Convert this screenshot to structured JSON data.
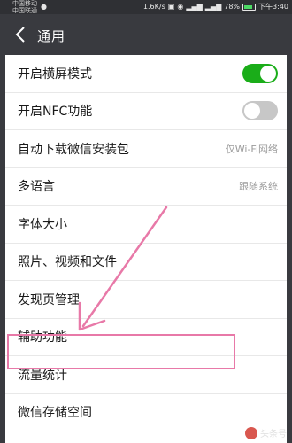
{
  "status_bar": {
    "carrier_1": "中国移动",
    "carrier_2": "中国联通",
    "speed": "1.6K/s",
    "battery_percent": "78%",
    "battery_level": 0.78,
    "time": "下午3:40"
  },
  "nav": {
    "title": "通用"
  },
  "settings": {
    "items": [
      {
        "label": "开启横屏模式",
        "toggle": "on"
      },
      {
        "label": "开启NFC功能",
        "toggle": "off"
      },
      {
        "label": "自动下载微信安装包",
        "value": "仅Wi-Fi网络"
      },
      {
        "label": "多语言",
        "value": "跟随系统"
      },
      {
        "label": "字体大小"
      },
      {
        "label": "照片、视频和文件"
      },
      {
        "label": "发现页管理"
      },
      {
        "label": "辅助功能"
      },
      {
        "label": "流量统计"
      },
      {
        "label": "微信存储空间"
      }
    ]
  },
  "colors": {
    "toggle_on": "#1aad19",
    "toggle_off": "#c7c7c7",
    "annotation": "#e879a8",
    "header_bg": "#393a3f"
  },
  "watermark": {
    "text": "头条号"
  }
}
